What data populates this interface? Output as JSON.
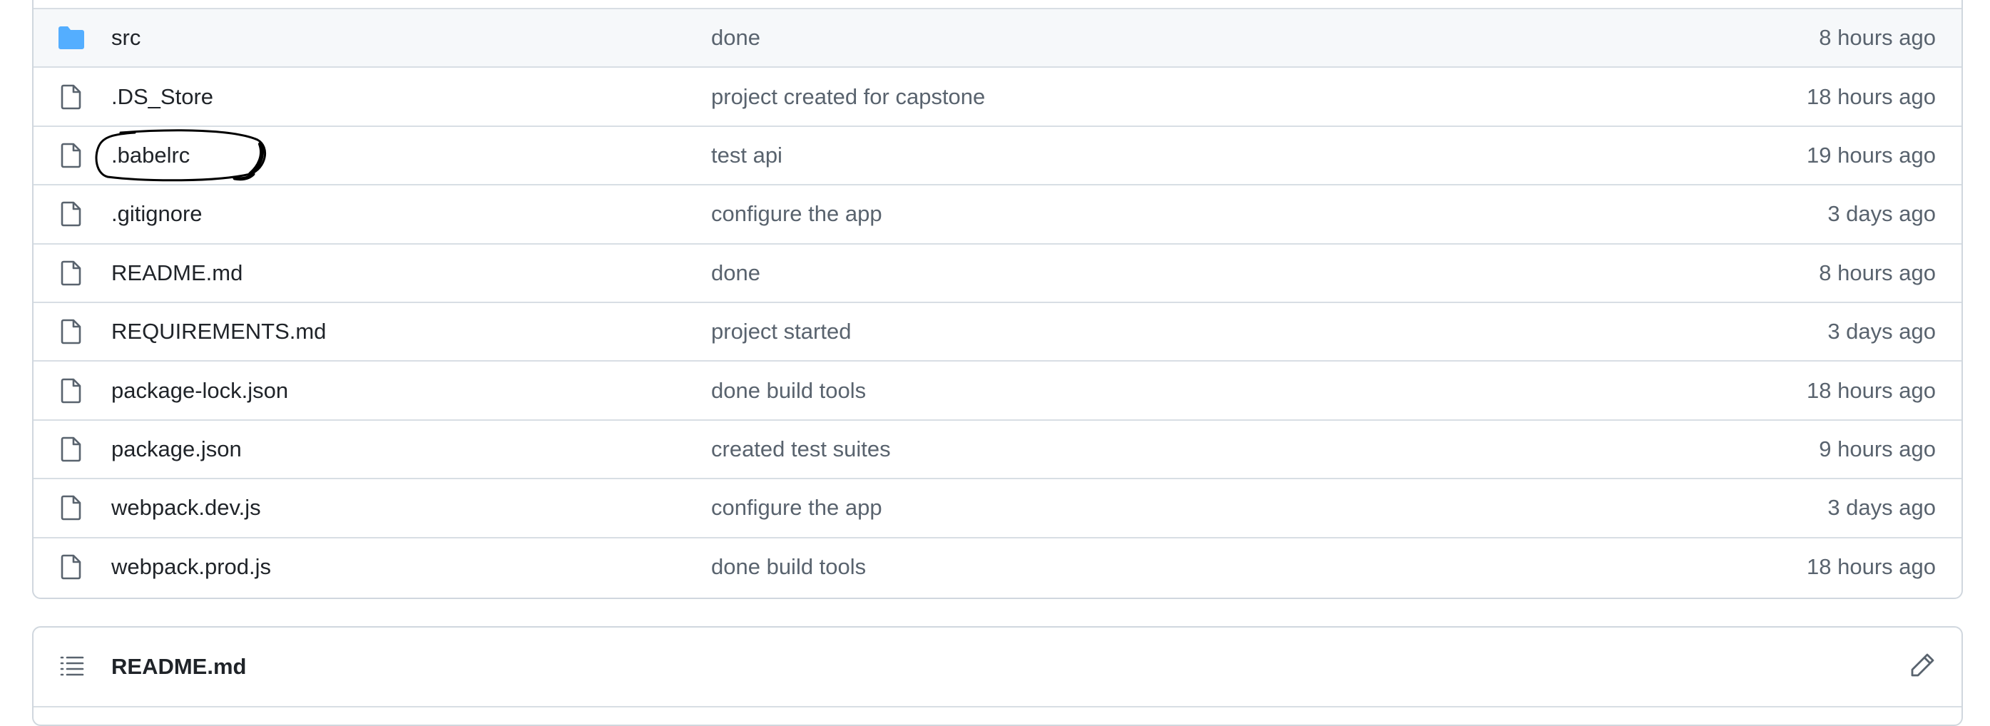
{
  "files": [
    {
      "name": "src",
      "type": "folder",
      "message": "done",
      "time": "8 hours ago"
    },
    {
      "name": ".DS_Store",
      "type": "file",
      "message": "project created for capstone",
      "time": "18 hours ago"
    },
    {
      "name": ".babelrc",
      "type": "file",
      "message": "test api",
      "time": "19 hours ago"
    },
    {
      "name": ".gitignore",
      "type": "file",
      "message": "configure the app",
      "time": "3 days ago"
    },
    {
      "name": "README.md",
      "type": "file",
      "message": "done",
      "time": "8 hours ago"
    },
    {
      "name": "REQUIREMENTS.md",
      "type": "file",
      "message": "project started",
      "time": "3 days ago"
    },
    {
      "name": "package-lock.json",
      "type": "file",
      "message": "done build tools",
      "time": "18 hours ago"
    },
    {
      "name": "package.json",
      "type": "file",
      "message": "created test suites",
      "time": "9 hours ago"
    },
    {
      "name": "webpack.dev.js",
      "type": "file",
      "message": "configure the app",
      "time": "3 days ago"
    },
    {
      "name": "webpack.prod.js",
      "type": "file",
      "message": "done build tools",
      "time": "18 hours ago"
    }
  ],
  "readme": {
    "title": "README.md",
    "icons": {
      "list": "list-icon",
      "edit": "pencil-icon"
    }
  },
  "colors": {
    "folder": "#54aeff",
    "file_icon": "#59636e",
    "annotation": "#000000"
  }
}
